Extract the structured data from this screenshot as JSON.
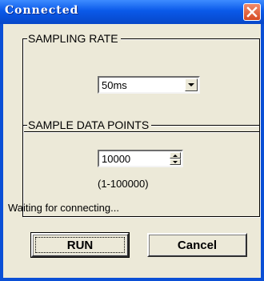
{
  "window": {
    "title": "Connected"
  },
  "sampling_rate": {
    "label": "SAMPLING RATE",
    "selected": "50ms"
  },
  "sample_points": {
    "label": "SAMPLE DATA POINTS",
    "value": "10000",
    "range": "(1-100000)"
  },
  "status": {
    "text": "Waiting for connecting..."
  },
  "buttons": {
    "run": "RUN",
    "cancel": "Cancel"
  },
  "colors": {
    "titlebar": "#0a59e9",
    "close": "#d64a23",
    "background": "#ece9d8"
  },
  "icons": {
    "close": "close-icon",
    "dropdown": "chevron-down-icon",
    "up": "spin-up-icon",
    "down": "spin-down-icon"
  }
}
